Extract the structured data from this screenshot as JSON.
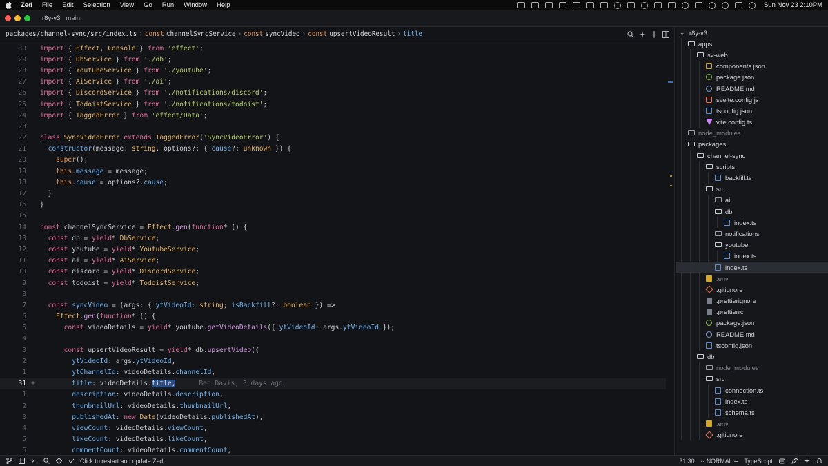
{
  "menubar": {
    "app_name": "Zed",
    "items": [
      "File",
      "Edit",
      "Selection",
      "View",
      "Go",
      "Run",
      "Window",
      "Help"
    ],
    "clock": "Sun Nov 23  2:10PM"
  },
  "titlebar": {
    "project": "r8y-v3",
    "branch": "main"
  },
  "breadcrumb": {
    "path": "packages/channel-sync/src/index.ts",
    "symbols": [
      {
        "kw": "const",
        "name": "channelSyncService"
      },
      {
        "kw": "const",
        "name": "syncVideo"
      },
      {
        "kw": "const",
        "name": "upsertVideoResult"
      },
      {
        "kw": "",
        "name": "title"
      }
    ]
  },
  "code_lines": [
    {
      "ln": "30",
      "html": "<span class='t-kw'>import</span> { <span class='t-type'>Effect</span>, <span class='t-type'>Console</span> } <span class='t-kw'>from</span> <span class='t-str'>'effect'</span>;"
    },
    {
      "ln": "29",
      "html": "<span class='t-kw'>import</span> { <span class='t-type'>DbService</span> } <span class='t-kw'>from</span> <span class='t-str'>'./db'</span>;"
    },
    {
      "ln": "28",
      "html": "<span class='t-kw'>import</span> { <span class='t-type'>YoutubeService</span> } <span class='t-kw'>from</span> <span class='t-str'>'./youtube'</span>;"
    },
    {
      "ln": "27",
      "html": "<span class='t-kw'>import</span> { <span class='t-type'>AiService</span> } <span class='t-kw'>from</span> <span class='t-str'>'./ai'</span>;"
    },
    {
      "ln": "26",
      "html": "<span class='t-kw'>import</span> { <span class='t-type'>DiscordService</span> } <span class='t-kw'>from</span> <span class='t-str'>'./notifications/discord'</span>;"
    },
    {
      "ln": "25",
      "html": "<span class='t-kw'>import</span> { <span class='t-type'>TodoistService</span> } <span class='t-kw'>from</span> <span class='t-str'>'./notifications/todoist'</span>;"
    },
    {
      "ln": "24",
      "html": "<span class='t-kw'>import</span> { <span class='t-type'>TaggedError</span> } <span class='t-kw'>from</span> <span class='t-str'>'effect/Data'</span>;"
    },
    {
      "ln": "23",
      "html": ""
    },
    {
      "ln": "22",
      "html": "<span class='t-kw'>class</span> <span class='t-type'>SyncVideoError</span> <span class='t-kw'>extends</span> <span class='t-type'>TaggedError</span>(<span class='t-str'>'SyncVideoError'</span>) {"
    },
    {
      "ln": "21",
      "html": "  <span class='t-prop'>constructor</span>(message: <span class='t-type'>string</span>, options?: { <span class='t-prop'>cause</span>?: <span class='t-type'>unknown</span> }) {"
    },
    {
      "ln": "20",
      "html": "    <span class='t-kw2'>super</span>();"
    },
    {
      "ln": "19",
      "html": "    <span class='t-kw2'>this</span>.<span class='t-prop'>message</span> = message;"
    },
    {
      "ln": "18",
      "html": "    <span class='t-kw2'>this</span>.<span class='t-prop'>cause</span> = options?.<span class='t-prop'>cause</span>;"
    },
    {
      "ln": "17",
      "html": "  }"
    },
    {
      "ln": "16",
      "html": "}"
    },
    {
      "ln": "15",
      "html": ""
    },
    {
      "ln": "14",
      "html": "<span class='t-kw'>const</span> channelSyncService = <span class='t-type'>Effect</span>.<span class='t-fn'>gen</span>(<span class='t-kw'>function</span>* () {"
    },
    {
      "ln": "13",
      "html": "  <span class='t-kw'>const</span> db = <span class='t-kw'>yield</span>* <span class='t-type'>DbService</span>;"
    },
    {
      "ln": "12",
      "html": "  <span class='t-kw'>const</span> youtube = <span class='t-kw'>yield</span>* <span class='t-type'>YoutubeService</span>;"
    },
    {
      "ln": "11",
      "html": "  <span class='t-kw'>const</span> ai = <span class='t-kw'>yield</span>* <span class='t-type'>AiService</span>;"
    },
    {
      "ln": "10",
      "html": "  <span class='t-kw'>const</span> discord = <span class='t-kw'>yield</span>* <span class='t-type'>DiscordService</span>;"
    },
    {
      "ln": "9",
      "html": "  <span class='t-kw'>const</span> todoist = <span class='t-kw'>yield</span>* <span class='t-type'>TodoistService</span>;"
    },
    {
      "ln": "8",
      "html": ""
    },
    {
      "ln": "7",
      "html": "  <span class='t-kw'>const</span> <span class='t-prop'>syncVideo</span> = (args: { <span class='t-prop'>ytVideoId</span>: <span class='t-type'>string</span>; <span class='t-prop'>isBackfill</span>?: <span class='t-type'>boolean</span> }) =>"
    },
    {
      "ln": "6",
      "html": "    <span class='t-type'>Effect</span>.<span class='t-fn'>gen</span>(<span class='t-kw'>function</span>* () {"
    },
    {
      "ln": "5",
      "html": "      <span class='t-kw'>const</span> videoDetails = <span class='t-kw'>yield</span>* youtube.<span class='t-fn'>getVideoDetails</span>({ <span class='t-prop'>ytVideoId</span>: args.<span class='t-prop'>ytVideoId</span> });"
    },
    {
      "ln": "4",
      "html": ""
    },
    {
      "ln": "3",
      "html": "      <span class='t-kw'>const</span> upsertVideoResult = <span class='t-kw'>yield</span>* db.<span class='t-fn'>upsertVideo</span>({"
    },
    {
      "ln": "2",
      "html": "        <span class='t-prop'>ytVideoId</span>: args.<span class='t-prop'>ytVideoId</span>,"
    },
    {
      "ln": "1",
      "html": "        <span class='t-prop'>ytChannelId</span>: videoDetails.<span class='t-prop'>channelId</span>,"
    },
    {
      "ln": "31",
      "current": true,
      "html": "        <span class='t-prop'>title</span>: videoDetails.<span class='sel'>title,</span><span class='blame'>Ben Davis, 3 days ago</span>"
    },
    {
      "ln": "1",
      "html": "        <span class='t-prop'>description</span>: videoDetails.<span class='t-prop'>description</span>,"
    },
    {
      "ln": "2",
      "html": "        <span class='t-prop'>thumbnailUrl</span>: videoDetails.<span class='t-prop'>thumbnailUrl</span>,"
    },
    {
      "ln": "3",
      "html": "        <span class='t-prop'>publishedAt</span>: <span class='t-kw'>new</span> <span class='t-type'>Date</span>(videoDetails.<span class='t-prop'>publishedAt</span>),"
    },
    {
      "ln": "4",
      "html": "        <span class='t-prop'>viewCount</span>: videoDetails.<span class='t-prop'>viewCount</span>,"
    },
    {
      "ln": "5",
      "html": "        <span class='t-prop'>likeCount</span>: videoDetails.<span class='t-prop'>likeCount</span>,"
    },
    {
      "ln": "6",
      "html": "        <span class='t-prop'>commentCount</span>: videoDetails.<span class='t-prop'>commentCount</span>,"
    }
  ],
  "tree": [
    {
      "label": "r8y-v3",
      "depth": 0,
      "icon": "none"
    },
    {
      "label": "apps",
      "depth": 1,
      "icon": "folder-open"
    },
    {
      "label": "sv-web",
      "depth": 2,
      "icon": "folder-open"
    },
    {
      "label": "components.json",
      "depth": 3,
      "icon": "js"
    },
    {
      "label": "package.json",
      "depth": 3,
      "icon": "json"
    },
    {
      "label": "README.md",
      "depth": 3,
      "icon": "md"
    },
    {
      "label": "svelte.config.js",
      "depth": 3,
      "icon": "svelte"
    },
    {
      "label": "tsconfig.json",
      "depth": 3,
      "icon": "ts"
    },
    {
      "label": "vite.config.ts",
      "depth": 3,
      "icon": "vite"
    },
    {
      "label": "node_modules",
      "depth": 1,
      "icon": "folder",
      "dim": true
    },
    {
      "label": "packages",
      "depth": 1,
      "icon": "folder-open"
    },
    {
      "label": "channel-sync",
      "depth": 2,
      "icon": "folder-open"
    },
    {
      "label": "scripts",
      "depth": 3,
      "icon": "folder-open"
    },
    {
      "label": "backfill.ts",
      "depth": 4,
      "icon": "ts"
    },
    {
      "label": "src",
      "depth": 3,
      "icon": "folder-open"
    },
    {
      "label": "ai",
      "depth": 4,
      "icon": "folder"
    },
    {
      "label": "db",
      "depth": 4,
      "icon": "folder-open"
    },
    {
      "label": "index.ts",
      "depth": 5,
      "icon": "ts"
    },
    {
      "label": "notifications",
      "depth": 4,
      "icon": "folder"
    },
    {
      "label": "youtube",
      "depth": 4,
      "icon": "folder-open"
    },
    {
      "label": "index.ts",
      "depth": 5,
      "icon": "ts"
    },
    {
      "label": "index.ts",
      "depth": 4,
      "icon": "ts",
      "active": true
    },
    {
      "label": ".env",
      "depth": 3,
      "icon": "env",
      "dim": true
    },
    {
      "label": ".gitignore",
      "depth": 3,
      "icon": "git"
    },
    {
      "label": ".prettierignore",
      "depth": 3,
      "icon": "prettier"
    },
    {
      "label": ".prettierrc",
      "depth": 3,
      "icon": "prettier"
    },
    {
      "label": "package.json",
      "depth": 3,
      "icon": "json"
    },
    {
      "label": "README.md",
      "depth": 3,
      "icon": "md"
    },
    {
      "label": "tsconfig.json",
      "depth": 3,
      "icon": "ts"
    },
    {
      "label": "db",
      "depth": 2,
      "icon": "folder-open"
    },
    {
      "label": "node_modules",
      "depth": 3,
      "icon": "folder",
      "dim": true
    },
    {
      "label": "src",
      "depth": 3,
      "icon": "folder-open"
    },
    {
      "label": "connection.ts",
      "depth": 4,
      "icon": "ts"
    },
    {
      "label": "index.ts",
      "depth": 4,
      "icon": "ts"
    },
    {
      "label": "schema.ts",
      "depth": 4,
      "icon": "ts"
    },
    {
      "label": ".env",
      "depth": 3,
      "icon": "env",
      "dim": true
    },
    {
      "label": ".gitignore",
      "depth": 3,
      "icon": "git"
    }
  ],
  "statusbar": {
    "message": "Click to restart and update Zed",
    "cursor": "31:30",
    "mode": "-- NORMAL --",
    "language": "TypeScript"
  },
  "colors": {
    "accent": "#2c4e86",
    "background": "#131417",
    "panel": "#16171a"
  }
}
